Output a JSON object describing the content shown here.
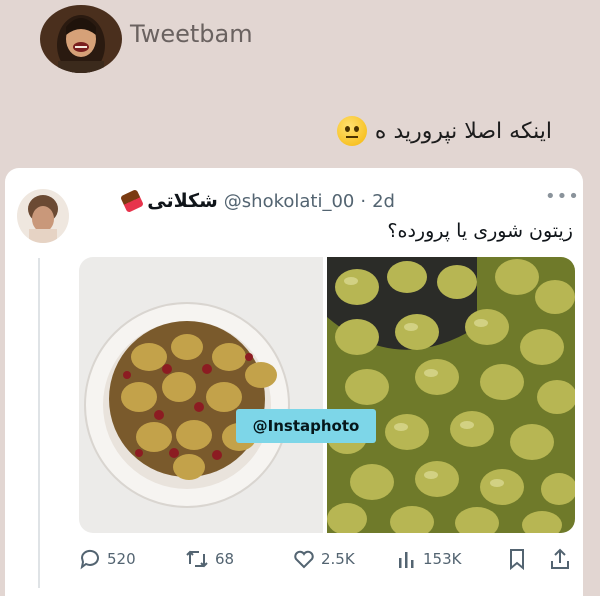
{
  "channel": {
    "name": "Tweetbam"
  },
  "caption": {
    "text": "اینکه اصلا نپرورید ه",
    "emoji": "neutral-face-emoji"
  },
  "tweet": {
    "display_name": "شکلاتی",
    "handle": "@shokolati_00",
    "time_separator": "·",
    "time": "2d",
    "text": "زیتون شوری یا پرورده؟",
    "watermark": "@Instaphoto",
    "stats": {
      "replies": "520",
      "retweets": "68",
      "likes": "2.5K",
      "views": "153K"
    }
  },
  "colors": {
    "background": "#e2d6d2",
    "card": "#ffffff",
    "muted_text": "#536471",
    "watermark_bg": "#7dd6e8"
  }
}
